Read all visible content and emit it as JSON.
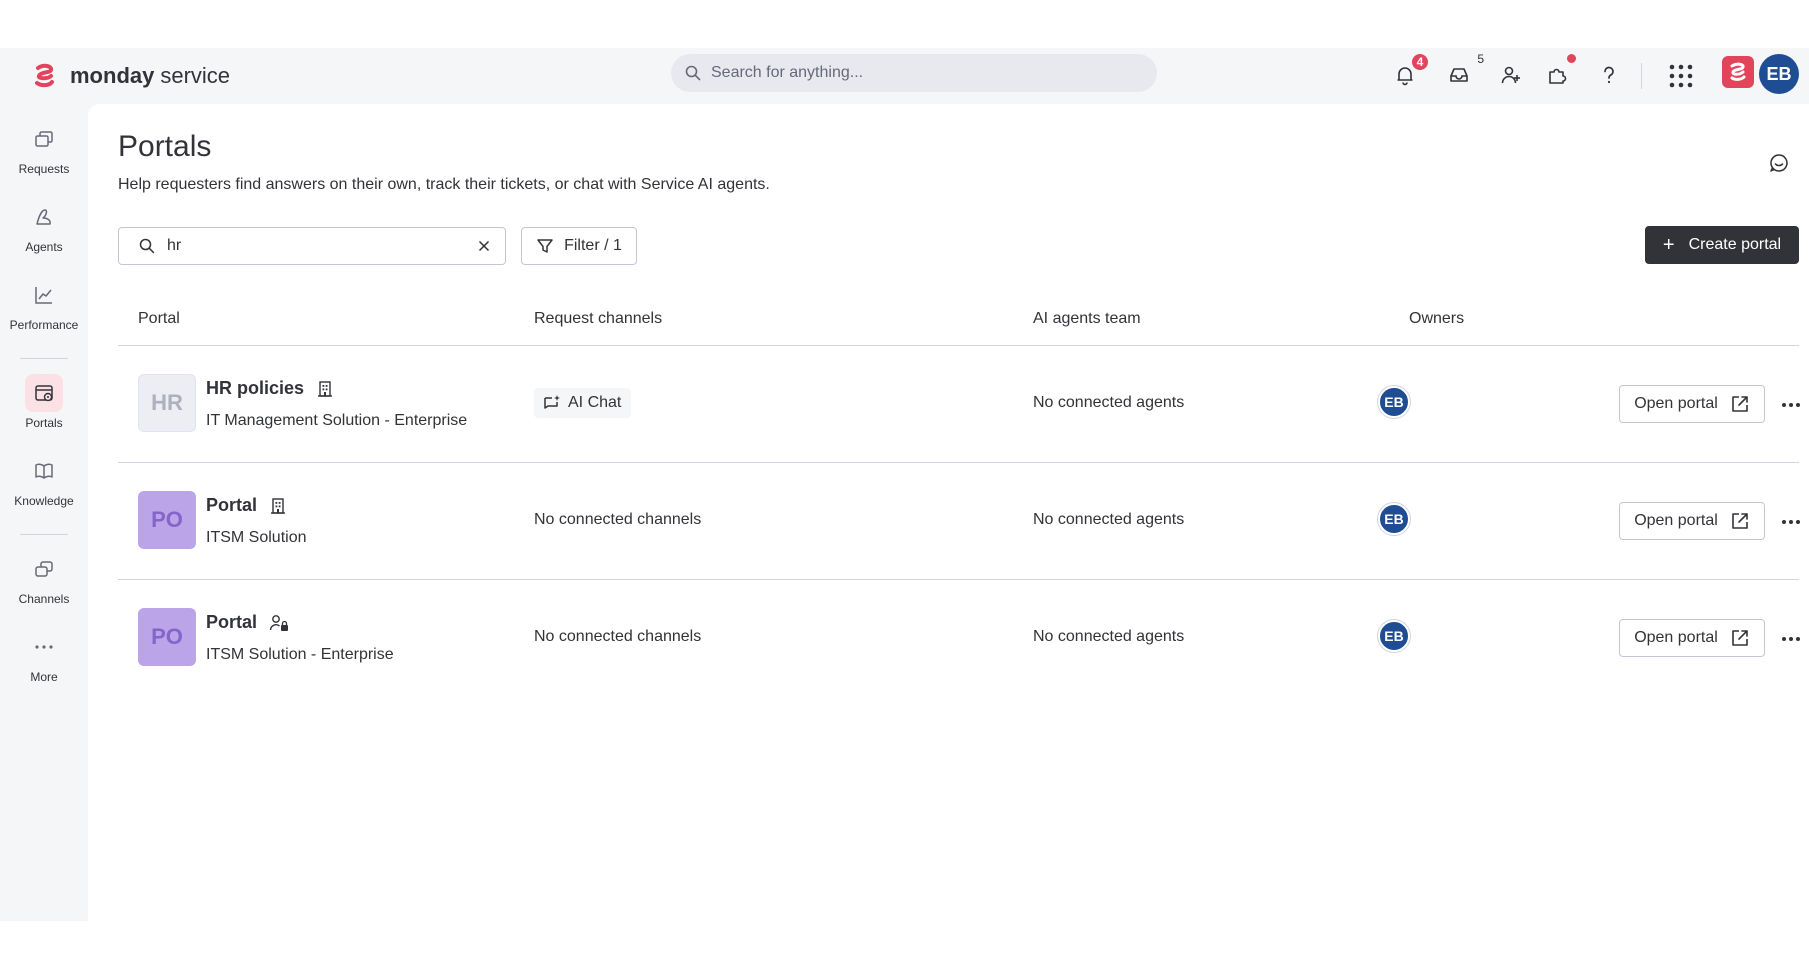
{
  "app": {
    "brand_bold": "monday",
    "brand_light": "service",
    "search_placeholder": "Search for anything...",
    "notifications_count": "4",
    "inbox_count": "5",
    "user_initials": "EB",
    "accent_color": "#e2445c",
    "avatar_color": "#1f4d94"
  },
  "sidebar": {
    "items": [
      {
        "label": "Requests",
        "icon": "requests-icon"
      },
      {
        "label": "Agents",
        "icon": "agents-icon"
      },
      {
        "label": "Performance",
        "icon": "performance-icon"
      },
      {
        "label": "Portals",
        "icon": "portals-icon",
        "active": true
      },
      {
        "label": "Knowledge",
        "icon": "knowledge-icon"
      },
      {
        "label": "Channels",
        "icon": "channels-icon"
      },
      {
        "label": "More",
        "icon": "more-icon"
      }
    ]
  },
  "page": {
    "title": "Portals",
    "subtitle": "Help requesters find answers on their own, track their tickets, or chat with Service AI agents.",
    "search_value": "hr",
    "filter_label": "Filter / 1",
    "create_label": "Create portal"
  },
  "table": {
    "headers": [
      "Portal",
      "Request channels",
      "AI agents team",
      "Owners"
    ],
    "open_label": "Open portal",
    "rows": [
      {
        "thumb": "HR",
        "name": "HR policies",
        "solution": "IT Management Solution - Enterprise",
        "channels": "AI Chat",
        "agents": "No connected agents",
        "owner": "EB",
        "access_icon": "building-icon"
      },
      {
        "thumb": "PO",
        "name": "Portal",
        "solution": "ITSM Solution",
        "channels": "No connected channels",
        "agents": "No connected agents",
        "owner": "EB",
        "access_icon": "building-icon"
      },
      {
        "thumb": "PO",
        "name": "Portal",
        "solution": "ITSM Solution - Enterprise",
        "channels": "No connected channels",
        "agents": "No connected agents",
        "owner": "EB",
        "access_icon": "user-lock-icon"
      }
    ]
  }
}
